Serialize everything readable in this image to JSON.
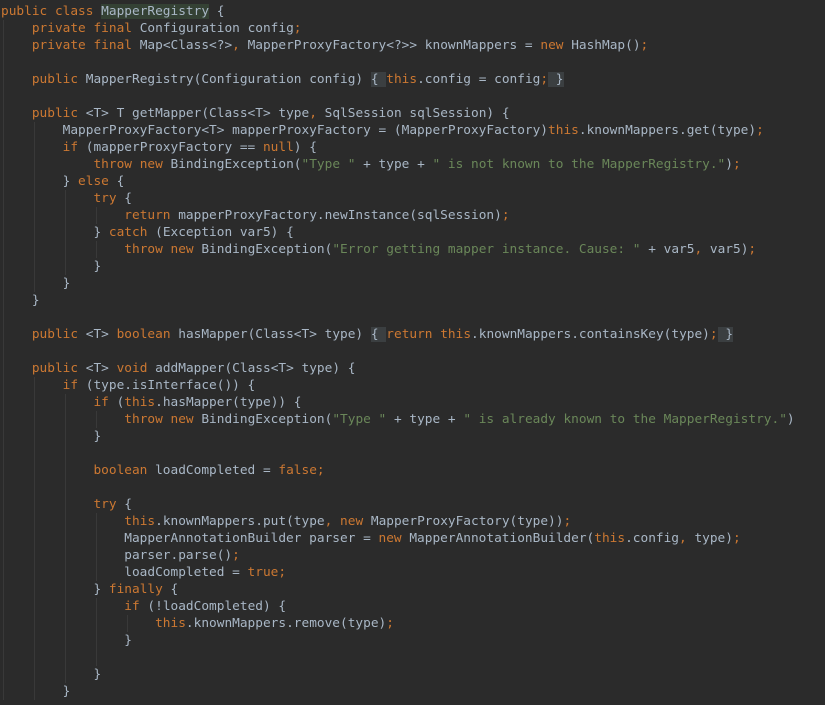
{
  "editor": {
    "lines": [
      [
        {
          "t": "public ",
          "c": "kw"
        },
        {
          "t": "class ",
          "c": "kw"
        },
        {
          "t": "MapperRegistry",
          "c": "hl-name"
        },
        {
          "t": " {",
          "c": ""
        }
      ],
      [
        {
          "t": "    ",
          "c": ""
        },
        {
          "t": "private ",
          "c": "kw"
        },
        {
          "t": "final ",
          "c": "kw"
        },
        {
          "t": "Configuration config",
          "c": ""
        },
        {
          "t": ";",
          "c": "kw"
        }
      ],
      [
        {
          "t": "    ",
          "c": ""
        },
        {
          "t": "private ",
          "c": "kw"
        },
        {
          "t": "final ",
          "c": "kw"
        },
        {
          "t": "Map<Class<?>",
          "c": ""
        },
        {
          "t": ", ",
          "c": "kw"
        },
        {
          "t": "MapperProxyFactory<?>> knownMappers = ",
          "c": ""
        },
        {
          "t": "new ",
          "c": "kw"
        },
        {
          "t": "HashMap()",
          "c": ""
        },
        {
          "t": ";",
          "c": "kw"
        }
      ],
      [],
      [
        {
          "t": "    ",
          "c": ""
        },
        {
          "t": "public ",
          "c": "kw"
        },
        {
          "t": "MapperRegistry(Configuration config) ",
          "c": ""
        },
        {
          "t": "{ ",
          "c": "fold"
        },
        {
          "t": "this",
          "c": "kw"
        },
        {
          "t": ".config = config",
          "c": ""
        },
        {
          "t": ";",
          "c": "kw"
        },
        {
          "t": " }",
          "c": "fold"
        }
      ],
      [],
      [
        {
          "t": "    ",
          "c": ""
        },
        {
          "t": "public ",
          "c": "kw"
        },
        {
          "t": "<T> T getMapper(Class<T> type",
          "c": ""
        },
        {
          "t": ", ",
          "c": "kw"
        },
        {
          "t": "SqlSession sqlSession) {",
          "c": ""
        }
      ],
      [
        {
          "t": "        ",
          "c": ""
        },
        {
          "t": "MapperProxyFactory<T> mapperProxyFactory = (MapperProxyFactory)",
          "c": ""
        },
        {
          "t": "this",
          "c": "kw"
        },
        {
          "t": ".knownMappers.get(type)",
          "c": ""
        },
        {
          "t": ";",
          "c": "kw"
        }
      ],
      [
        {
          "t": "        ",
          "c": ""
        },
        {
          "t": "if ",
          "c": "kw"
        },
        {
          "t": "(mapperProxyFactory == ",
          "c": ""
        },
        {
          "t": "null",
          "c": "kw"
        },
        {
          "t": ") {",
          "c": ""
        }
      ],
      [
        {
          "t": "            ",
          "c": ""
        },
        {
          "t": "throw ",
          "c": "kw"
        },
        {
          "t": "new ",
          "c": "kw"
        },
        {
          "t": "BindingException(",
          "c": ""
        },
        {
          "t": "\"Type \"",
          "c": "str"
        },
        {
          "t": " + type + ",
          "c": ""
        },
        {
          "t": "\" is not known to the MapperRegistry.\"",
          "c": "str"
        },
        {
          "t": ")",
          "c": ""
        },
        {
          "t": ";",
          "c": "kw"
        }
      ],
      [
        {
          "t": "        } ",
          "c": ""
        },
        {
          "t": "else ",
          "c": "kw"
        },
        {
          "t": "{",
          "c": ""
        }
      ],
      [
        {
          "t": "            ",
          "c": ""
        },
        {
          "t": "try ",
          "c": "kw"
        },
        {
          "t": "{",
          "c": ""
        }
      ],
      [
        {
          "t": "                ",
          "c": ""
        },
        {
          "t": "return ",
          "c": "kw"
        },
        {
          "t": "mapperProxyFactory.newInstance(sqlSession)",
          "c": ""
        },
        {
          "t": ";",
          "c": "kw"
        }
      ],
      [
        {
          "t": "            } ",
          "c": ""
        },
        {
          "t": "catch ",
          "c": "kw"
        },
        {
          "t": "(Exception var5) {",
          "c": ""
        }
      ],
      [
        {
          "t": "                ",
          "c": ""
        },
        {
          "t": "throw ",
          "c": "kw"
        },
        {
          "t": "new ",
          "c": "kw"
        },
        {
          "t": "BindingException(",
          "c": ""
        },
        {
          "t": "\"Error getting mapper instance. Cause: \"",
          "c": "str"
        },
        {
          "t": " + var5",
          "c": ""
        },
        {
          "t": ", ",
          "c": "kw"
        },
        {
          "t": "var5)",
          "c": ""
        },
        {
          "t": ";",
          "c": "kw"
        }
      ],
      [
        {
          "t": "            }",
          "c": ""
        }
      ],
      [
        {
          "t": "        }",
          "c": ""
        }
      ],
      [
        {
          "t": "    }",
          "c": ""
        }
      ],
      [],
      [
        {
          "t": "    ",
          "c": ""
        },
        {
          "t": "public ",
          "c": "kw"
        },
        {
          "t": "<T> ",
          "c": ""
        },
        {
          "t": "boolean ",
          "c": "kw"
        },
        {
          "t": "hasMapper(Class<T> type) ",
          "c": ""
        },
        {
          "t": "{ ",
          "c": "fold"
        },
        {
          "t": "return ",
          "c": "kw"
        },
        {
          "t": "this",
          "c": "kw"
        },
        {
          "t": ".knownMappers.containsKey(type)",
          "c": ""
        },
        {
          "t": ";",
          "c": "kw"
        },
        {
          "t": " }",
          "c": "fold"
        }
      ],
      [],
      [
        {
          "t": "    ",
          "c": ""
        },
        {
          "t": "public ",
          "c": "kw"
        },
        {
          "t": "<T> ",
          "c": ""
        },
        {
          "t": "void ",
          "c": "kw"
        },
        {
          "t": "addMapper(Class<T> type) {",
          "c": ""
        }
      ],
      [
        {
          "t": "        ",
          "c": ""
        },
        {
          "t": "if ",
          "c": "kw"
        },
        {
          "t": "(type.isInterface()) {",
          "c": ""
        }
      ],
      [
        {
          "t": "            ",
          "c": ""
        },
        {
          "t": "if ",
          "c": "kw"
        },
        {
          "t": "(",
          "c": ""
        },
        {
          "t": "this",
          "c": "kw"
        },
        {
          "t": ".hasMapper(type)) {",
          "c": ""
        }
      ],
      [
        {
          "t": "                ",
          "c": ""
        },
        {
          "t": "throw ",
          "c": "kw"
        },
        {
          "t": "new ",
          "c": "kw"
        },
        {
          "t": "BindingException(",
          "c": ""
        },
        {
          "t": "\"Type \"",
          "c": "str"
        },
        {
          "t": " + type + ",
          "c": ""
        },
        {
          "t": "\" is already known to the MapperRegistry.\"",
          "c": "str"
        },
        {
          "t": ")",
          "c": ""
        }
      ],
      [
        {
          "t": "            }",
          "c": ""
        }
      ],
      [],
      [
        {
          "t": "            ",
          "c": ""
        },
        {
          "t": "boolean ",
          "c": "kw"
        },
        {
          "t": "loadCompleted = ",
          "c": ""
        },
        {
          "t": "false",
          "c": "kw"
        },
        {
          "t": ";",
          "c": "kw"
        }
      ],
      [],
      [
        {
          "t": "            ",
          "c": ""
        },
        {
          "t": "try ",
          "c": "kw"
        },
        {
          "t": "{",
          "c": ""
        }
      ],
      [
        {
          "t": "                ",
          "c": ""
        },
        {
          "t": "this",
          "c": "kw"
        },
        {
          "t": ".knownMappers.put(type",
          "c": ""
        },
        {
          "t": ", ",
          "c": "kw"
        },
        {
          "t": "new ",
          "c": "kw"
        },
        {
          "t": "MapperProxyFactory(type))",
          "c": ""
        },
        {
          "t": ";",
          "c": "kw"
        }
      ],
      [
        {
          "t": "                MapperAnnotationBuilder parser = ",
          "c": ""
        },
        {
          "t": "new ",
          "c": "kw"
        },
        {
          "t": "MapperAnnotationBuilder(",
          "c": ""
        },
        {
          "t": "this",
          "c": "kw"
        },
        {
          "t": ".config",
          "c": ""
        },
        {
          "t": ", ",
          "c": "kw"
        },
        {
          "t": "type)",
          "c": ""
        },
        {
          "t": ";",
          "c": "kw"
        }
      ],
      [
        {
          "t": "                parser.parse()",
          "c": ""
        },
        {
          "t": ";",
          "c": "kw"
        }
      ],
      [
        {
          "t": "                loadCompleted = ",
          "c": ""
        },
        {
          "t": "true",
          "c": "kw"
        },
        {
          "t": ";",
          "c": "kw"
        }
      ],
      [
        {
          "t": "            } ",
          "c": ""
        },
        {
          "t": "finally ",
          "c": "kw"
        },
        {
          "t": "{",
          "c": ""
        }
      ],
      [
        {
          "t": "                ",
          "c": ""
        },
        {
          "t": "if ",
          "c": "kw"
        },
        {
          "t": "(!loadCompleted) {",
          "c": ""
        }
      ],
      [
        {
          "t": "                    ",
          "c": ""
        },
        {
          "t": "this",
          "c": "kw"
        },
        {
          "t": ".knownMappers.remove(type)",
          "c": ""
        },
        {
          "t": ";",
          "c": "kw"
        }
      ],
      [
        {
          "t": "                }",
          "c": ""
        }
      ],
      [],
      [
        {
          "t": "            }",
          "c": ""
        }
      ],
      [
        {
          "t": "        }",
          "c": ""
        }
      ]
    ]
  }
}
